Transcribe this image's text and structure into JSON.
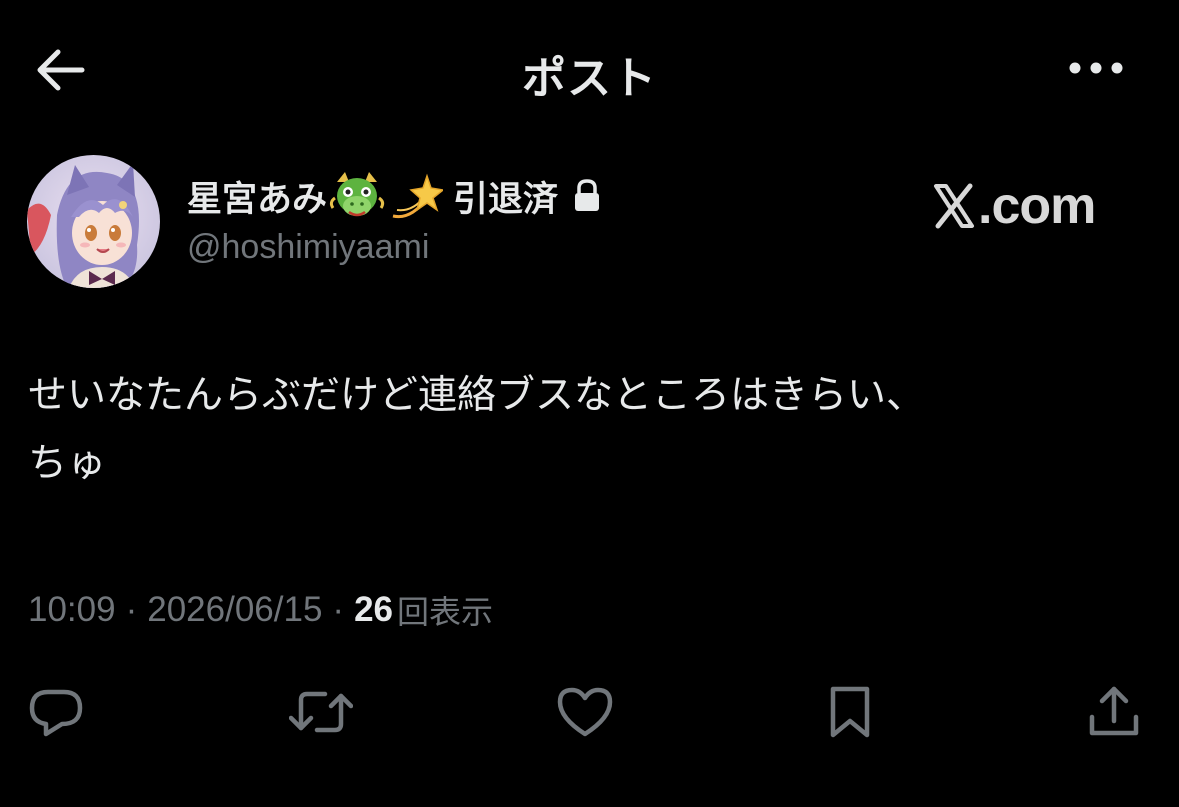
{
  "header": {
    "title": "ポスト",
    "back_icon": "arrow-left-icon",
    "more_icon": "more-horizontal-icon"
  },
  "author": {
    "display_name": "星宮あみ",
    "emojis": [
      "dragon-face-emoji",
      "dizzy-star-emoji"
    ],
    "status_text": "引退済",
    "lock_icon": "lock-icon",
    "handle": "@hoshimiyaami"
  },
  "watermark": {
    "prefix": "𝕏",
    "suffix": ".com"
  },
  "post": {
    "text_line1": "せいなたんらぶだけど連絡ブスなところはきらい、",
    "text_line2": "ちゅ"
  },
  "meta": {
    "time": "10:09",
    "date": "2026/06/15",
    "separator": "·",
    "views_count": "26",
    "views_label": "回表示"
  },
  "actions": {
    "reply_icon": "reply-icon",
    "repost_icon": "repost-icon",
    "like_icon": "heart-icon",
    "bookmark_icon": "bookmark-icon",
    "share_icon": "share-icon"
  },
  "colors": {
    "background": "#000000",
    "text_primary": "#e7e9ea",
    "text_secondary": "#71767b"
  }
}
